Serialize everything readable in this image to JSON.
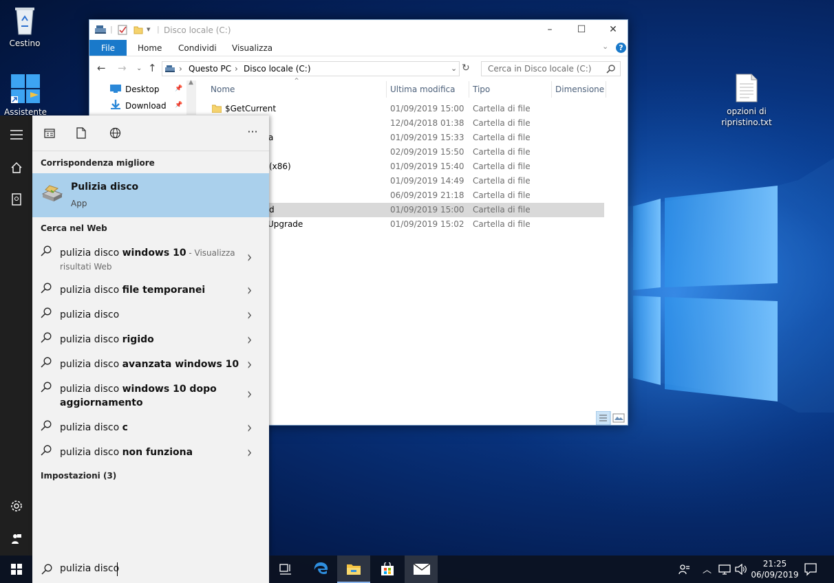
{
  "desktop": {
    "icons": [
      {
        "name": "recycle-bin",
        "label": "Cestino"
      },
      {
        "name": "assistant",
        "label": "Assistente"
      },
      {
        "name": "text-file",
        "label": "opzioni di ripristino.txt"
      }
    ]
  },
  "explorer": {
    "title": "Disco locale (C:)",
    "ribbon_tabs": [
      "File",
      "Home",
      "Condividi",
      "Visualizza"
    ],
    "breadcrumb": [
      "Questo PC",
      "Disco locale (C:)"
    ],
    "search_placeholder": "Cerca in Disco locale (C:)",
    "nav_items": [
      "Desktop",
      "Download"
    ],
    "columns": [
      "Nome",
      "Ultima modifica",
      "Tipo",
      "Dimensione"
    ],
    "rows": [
      {
        "name": "$GetCurrent",
        "date": "01/09/2019 15:00",
        "type": "Cartella di file"
      },
      {
        "name": "",
        "date": "12/04/2018 01:38",
        "type": "Cartella di file"
      },
      {
        "name": "a",
        "date": "01/09/2019 15:33",
        "type": "Cartella di file"
      },
      {
        "name": "",
        "date": "02/09/2019 15:50",
        "type": "Cartella di file"
      },
      {
        "name": "(x86)",
        "date": "01/09/2019 15:40",
        "type": "Cartella di file"
      },
      {
        "name": "",
        "date": "01/09/2019 14:49",
        "type": "Cartella di file"
      },
      {
        "name": "",
        "date": "06/09/2019 21:18",
        "type": "Cartella di file"
      },
      {
        "name": "d",
        "date": "01/09/2019 15:00",
        "type": "Cartella di file"
      },
      {
        "name": "Upgrade",
        "date": "01/09/2019 15:02",
        "type": "Cartella di file"
      }
    ]
  },
  "search_panel": {
    "toolbar_more": "···",
    "best_match_header": "Corrispondenza migliore",
    "best_match": {
      "name": "Pulizia disco",
      "type": "App"
    },
    "web_header": "Cerca nel Web",
    "suggestions": [
      {
        "plain": "pulizia disco ",
        "bold": "windows 10",
        "dim": " - Visualizza risultati Web"
      },
      {
        "plain": "pulizia disco ",
        "bold": "file temporanei",
        "dim": ""
      },
      {
        "plain": "pulizia disco",
        "bold": "",
        "dim": ""
      },
      {
        "plain": "pulizia disco ",
        "bold": "rigido",
        "dim": ""
      },
      {
        "plain": "pulizia disco ",
        "bold": "avanzata windows 10",
        "dim": ""
      },
      {
        "plain": "pulizia disco ",
        "bold": "windows 10 dopo aggiornamento",
        "dim": ""
      },
      {
        "plain": "pulizia disco ",
        "bold": "c",
        "dim": ""
      },
      {
        "plain": "pulizia disco ",
        "bold": "non funziona",
        "dim": ""
      }
    ],
    "settings_header": "Impostazioni (3)"
  },
  "taskbar": {
    "search_text": "pulizia disco",
    "time": "21:25",
    "date": "06/09/2019"
  }
}
